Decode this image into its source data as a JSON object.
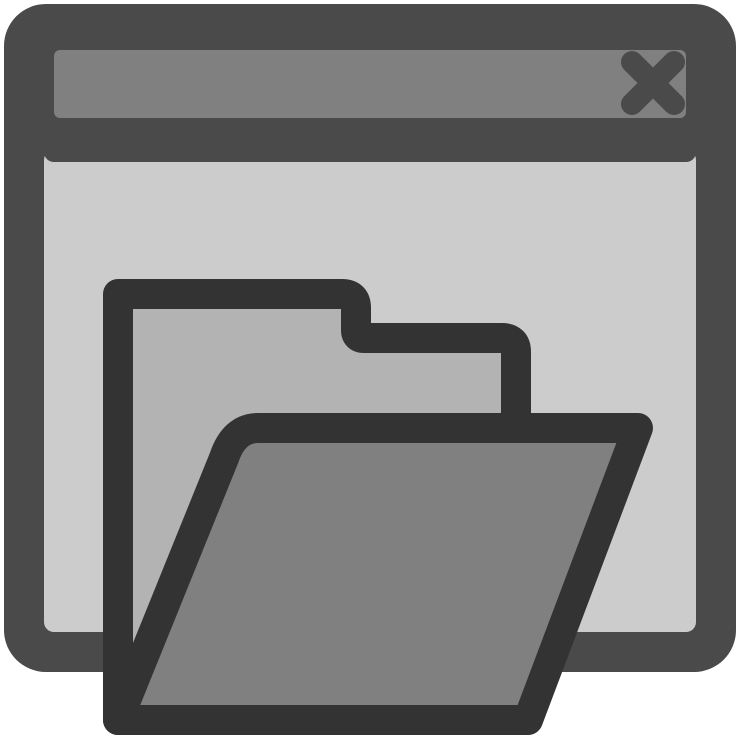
{
  "icon": {
    "name": "window-open-folder-icon",
    "elements": {
      "window": "application-window",
      "title_bar": "window-title-bar",
      "close": "close-icon",
      "folder": "open-folder-icon"
    }
  },
  "colors": {
    "outline_dark": "#333333",
    "frame": "#4a4a4a",
    "title_bar_fill": "#808080",
    "client_area": "#cccccc",
    "folder_back": "#b3b3b3",
    "folder_front": "#808080",
    "background": "#ffffff"
  }
}
